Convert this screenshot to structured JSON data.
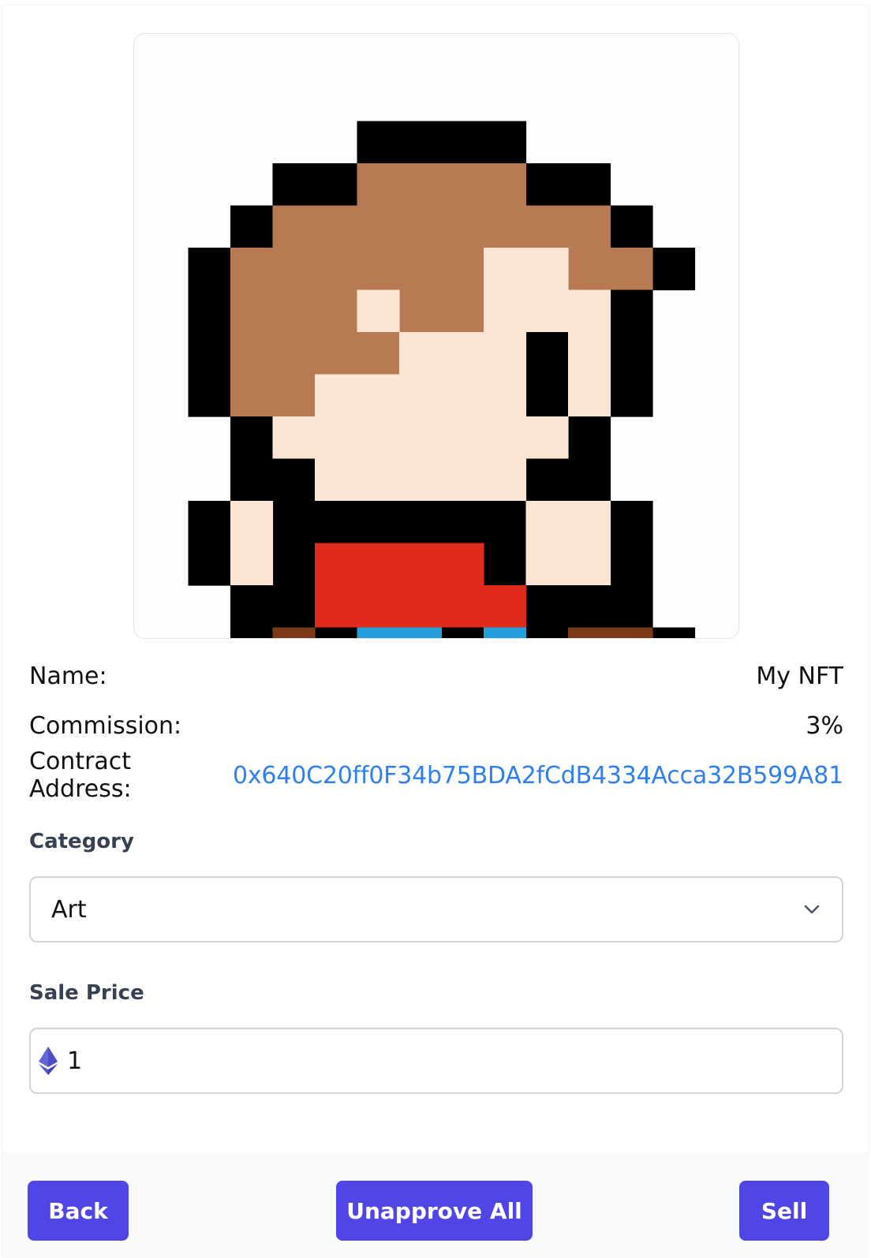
{
  "nft": {
    "image_alt": "pixel art character"
  },
  "details": {
    "name_label": "Name:",
    "name_value": "My NFT",
    "commission_label": "Commission:",
    "commission_value": "3%",
    "contract_label": "Contract Address:",
    "contract_value": "0x640C20ff0F34b75BDA2fCdB4334Acca32B599A81"
  },
  "category": {
    "label": "Category",
    "selected": "Art",
    "icon": "chevron-down-icon"
  },
  "sale_price": {
    "label": "Sale Price",
    "value": "1",
    "icon": "ethereum-icon"
  },
  "footer": {
    "back_label": "Back",
    "unapprove_label": "Unapprove All",
    "sell_label": "Sell"
  },
  "colors": {
    "accent": "#4f46e5",
    "link": "#2f80ed",
    "hair": "#b87a52",
    "skin": "#fde5d4",
    "shirt": "#e02a1a",
    "belt": "#239fdc",
    "boots": "#7a3a16",
    "outline": "#000000"
  }
}
